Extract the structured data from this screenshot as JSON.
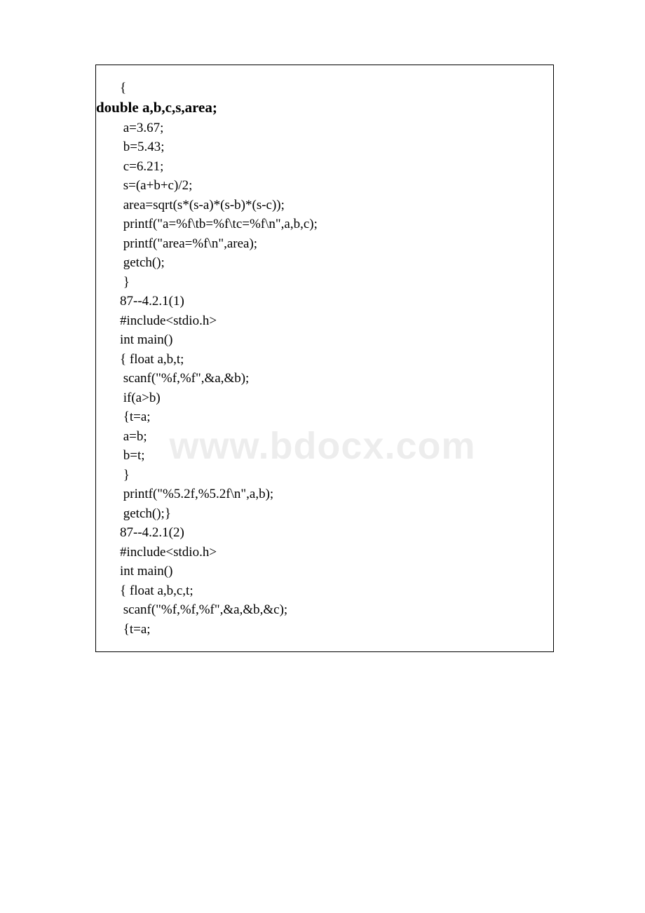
{
  "watermark": "www.bdocx.com",
  "code": {
    "lines": [
      {
        "text": "{",
        "bold": false
      },
      {
        "text": "double a,b,c,s,area;",
        "bold": true
      },
      {
        "text": " a=3.67;",
        "bold": false
      },
      {
        "text": " b=5.43;",
        "bold": false
      },
      {
        "text": " c=6.21;",
        "bold": false
      },
      {
        "text": " s=(a+b+c)/2;",
        "bold": false
      },
      {
        "text": " area=sqrt(s*(s-a)*(s-b)*(s-c));",
        "bold": false
      },
      {
        "text": " printf(\"a=%f\\tb=%f\\tc=%f\\n\",a,b,c);",
        "bold": false
      },
      {
        "text": " printf(\"area=%f\\n\",area);",
        "bold": false
      },
      {
        "text": " getch();",
        "bold": false
      },
      {
        "text": " }",
        "bold": false
      },
      {
        "text": "87--4.2.1(1)",
        "bold": false
      },
      {
        "text": "#include<stdio.h>",
        "bold": false
      },
      {
        "text": "int main()",
        "bold": false
      },
      {
        "text": "{ float a,b,t;",
        "bold": false
      },
      {
        "text": " scanf(\"%f,%f\",&a,&b);",
        "bold": false
      },
      {
        "text": " if(a>b)",
        "bold": false
      },
      {
        "text": " {t=a;",
        "bold": false
      },
      {
        "text": " a=b;",
        "bold": false
      },
      {
        "text": " b=t;",
        "bold": false
      },
      {
        "text": " }",
        "bold": false
      },
      {
        "text": " printf(\"%5.2f,%5.2f\\n\",a,b);",
        "bold": false
      },
      {
        "text": " getch();}",
        "bold": false
      },
      {
        "text": "87--4.2.1(2)",
        "bold": false
      },
      {
        "text": "#include<stdio.h>",
        "bold": false
      },
      {
        "text": "int main()",
        "bold": false
      },
      {
        "text": "{ float a,b,c,t;",
        "bold": false
      },
      {
        "text": " scanf(\"%f,%f,%f\",&a,&b,&c);",
        "bold": false
      },
      {
        "text": " {t=a;",
        "bold": false
      }
    ]
  }
}
